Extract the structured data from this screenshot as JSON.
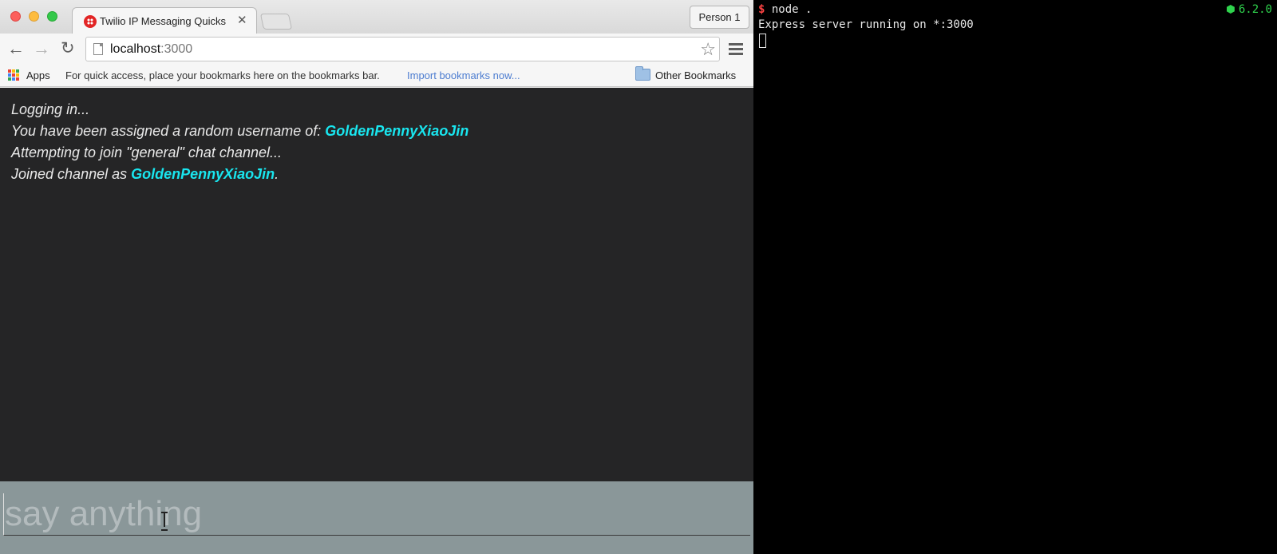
{
  "browser": {
    "tab": {
      "title": "Twilio IP Messaging Quickstart",
      "close_glyph": "✕"
    },
    "profile_label": "Person 1",
    "address_bar": {
      "host": "localhost",
      "port": ":3000"
    },
    "bookmarks_bar": {
      "apps_label": "Apps",
      "hint": "For quick access, place your bookmarks here on the bookmarks bar.",
      "import_link": "Import bookmarks now...",
      "other_bookmarks": "Other Bookmarks"
    },
    "icons": {
      "back": "arrow-left-icon",
      "forward": "arrow-right-icon",
      "reload": "reload-icon",
      "star": "star-icon",
      "menu": "hamburger-menu-icon"
    }
  },
  "chat": {
    "messages": [
      {
        "text": "Logging in..."
      },
      {
        "prefix": "You have been assigned a random username of: ",
        "username": "GoldenPennyXiaoJin"
      },
      {
        "text": "Attempting to join \"general\" chat channel..."
      },
      {
        "prefix": "Joined channel as ",
        "username": "GoldenPennyXiaoJin",
        "suffix": "."
      }
    ],
    "input": {
      "placeholder": "say anything",
      "value": ""
    },
    "colors": {
      "background": "#252526",
      "username": "#19e6ef",
      "input_area": "#8a9799"
    }
  },
  "terminal": {
    "prompt": "$",
    "command": " node .",
    "output": "Express server running on *:3000",
    "node_version": "6.2.0",
    "colors": {
      "prompt": "#ff4444",
      "version": "#2fd34d"
    }
  }
}
